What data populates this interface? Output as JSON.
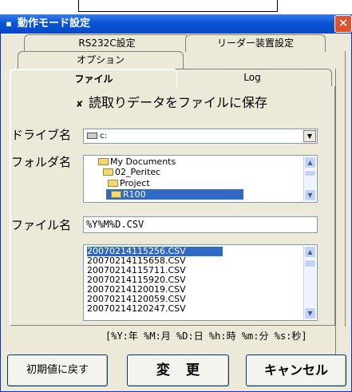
{
  "window": {
    "title": "動作モード設定",
    "close_label": "✕",
    "icon": "app-icon"
  },
  "tabs": {
    "row_back": [
      {
        "label": "RS232C設定"
      },
      {
        "label": "リーダー装置設定"
      }
    ],
    "row_mid": [
      {
        "label": "オプション"
      }
    ],
    "row_front": [
      {
        "label": "ファイル",
        "active": true
      },
      {
        "label": "Log",
        "active": false
      }
    ]
  },
  "file_tab": {
    "save_checkbox": {
      "checked": true,
      "mark": "✘",
      "label": "読取りデータをファイルに保存"
    },
    "drive": {
      "label": "ドライブ名",
      "value": "c:",
      "arrow": "▼"
    },
    "folder": {
      "label": "フォルダ名",
      "items": [
        "My Documents",
        "02_Peritec",
        "Project",
        "R100",
        ""
      ],
      "selected": "R100"
    },
    "filename": {
      "label": "ファイル名",
      "value": "%Y%M%D.CSV"
    },
    "files": [
      "20070214115256.CSV",
      "20070214115658.CSV",
      "20070214115711.CSV",
      "20070214115920.CSV",
      "20070214120019.CSV",
      "20070214120059.CSV",
      "20070214120247.CSV"
    ],
    "format_hint": "[%Y:年 %M:月 %D:日 %h:時 %m:分 %s:秒]"
  },
  "buttons": {
    "reset": "初期値に戻す",
    "change": "変更",
    "cancel": "キャンセル"
  },
  "colors": {
    "titlebar": "#0a55d8",
    "selection": "#316ac5",
    "dialog_bg": "#ece9d8",
    "close": "#e0522c"
  }
}
